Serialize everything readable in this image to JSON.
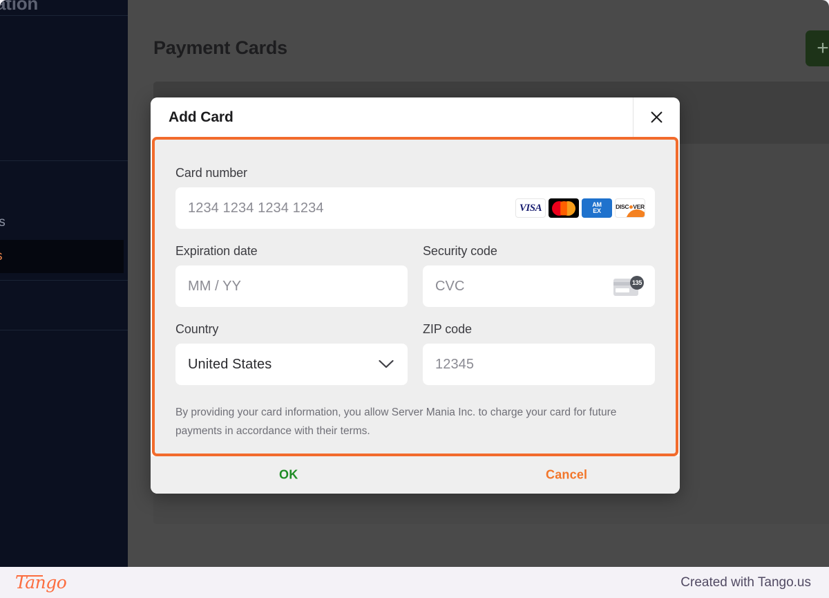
{
  "app": {
    "page_title": "Payment Cards",
    "add_button_icon": "plus-icon"
  },
  "sidebar": {
    "title_fragment": "ation",
    "items": [
      {
        "label": ""
      },
      {
        "label": ""
      },
      {
        "label": "ls"
      },
      {
        "label": "s",
        "active": true
      },
      {
        "label": ""
      }
    ]
  },
  "modal": {
    "title": "Add Card",
    "close_icon": "close-icon",
    "fields": {
      "card_number": {
        "label": "Card number",
        "placeholder": "1234 1234 1234 1234",
        "brands": [
          {
            "name": "visa",
            "text": "VISA"
          },
          {
            "name": "mastercard",
            "text": ""
          },
          {
            "name": "amex",
            "line1": "AM",
            "line2": "EX"
          },
          {
            "name": "discover",
            "text_before": "DISC",
            "text_after": "VER"
          }
        ]
      },
      "expiration": {
        "label": "Expiration date",
        "placeholder": "MM / YY"
      },
      "security_code": {
        "label": "Security code",
        "placeholder": "CVC",
        "icon": "cvc-card-icon",
        "icon_badge_text": "135"
      },
      "country": {
        "label": "Country",
        "value": "United States",
        "chevron_icon": "chevron-down-icon"
      },
      "zip": {
        "label": "ZIP code",
        "placeholder": "12345"
      }
    },
    "disclaimer": "By providing your card information, you allow Server Mania Inc. to charge your card for future payments in accordance with their terms.",
    "footer": {
      "ok_label": "OK",
      "cancel_label": "Cancel"
    }
  },
  "footer": {
    "logo_text": "Tango",
    "credit_text": "Created with Tango.us"
  },
  "colors": {
    "accent_orange": "#f26b2c",
    "ok_green": "#1f8c25",
    "cancel_orange": "#f2762a",
    "sidebar_bg": "#0b1020",
    "overlay_gray": "#4a4a4a"
  }
}
